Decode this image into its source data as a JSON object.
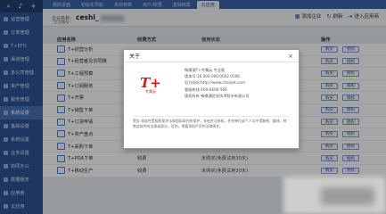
{
  "sidebar": {
    "top_icons": [
      "search-icon",
      "bell-icon",
      "add-icon"
    ],
    "items": [
      {
        "label": "运营管理"
      },
      {
        "label": "订单管理"
      },
      {
        "label": "T+EFO"
      },
      {
        "label": "渠道管理"
      },
      {
        "label": "多公司管理"
      },
      {
        "label": "资产管理"
      },
      {
        "label": "服务管理"
      },
      {
        "label": "系统设置",
        "active": true
      },
      {
        "label": "基础设置"
      },
      {
        "label": "系统设置"
      },
      {
        "label": "业务设置"
      },
      {
        "label": "协同办公"
      },
      {
        "label": "数据服务"
      },
      {
        "label": "应用商"
      },
      {
        "label": "云应用"
      }
    ]
  },
  "topbar": {
    "tabs": [
      {
        "label": "我的桌面"
      },
      {
        "label": "初始化导航"
      },
      {
        "label": "系统参数"
      },
      {
        "label": "用户/权限"
      },
      {
        "label": "基础档案"
      },
      {
        "label": "云应用",
        "active": true
      }
    ]
  },
  "account": {
    "label": "企业名称：",
    "name": "ceshi_",
    "sub": "企业编号："
  },
  "actions": {
    "add_account": "添加企业",
    "refresh": "刷新",
    "enter_app": "进入应用商"
  },
  "table": {
    "headers": {
      "app": "应用名称",
      "charge": "收费方式",
      "status": "使用状态",
      "ops": "操作"
    },
    "rows": [
      {
        "app": "T+经营分析",
        "charge": "",
        "status": "",
        "ops": [
          "购买",
          "授权"
        ]
      },
      {
        "app": "T+经营者及协同推",
        "charge": "",
        "status": "",
        "ops": [
          "购买",
          "授权"
        ]
      },
      {
        "app": "T+工程预算",
        "charge": "",
        "status": "",
        "ops": [
          "购买",
          "授权"
        ]
      },
      {
        "app": "T+订阅服务",
        "charge": "",
        "status": "",
        "ops": [
          "购买",
          "授权"
        ]
      },
      {
        "app": "T+开票",
        "charge": "",
        "status": "",
        "ops": [
          "购买",
          "授权"
        ]
      },
      {
        "app": "T+销售下单",
        "charge": "",
        "status": "",
        "ops": [
          "购买",
          "授权"
        ]
      },
      {
        "app": "T+订货申请",
        "charge": "",
        "status": "",
        "ops": [
          "购买",
          "授权"
        ]
      },
      {
        "app": "T+资产盘点",
        "charge": "收费",
        "status": "未购买(免费试用30天)",
        "ops": [
          "购买",
          "授权"
        ]
      },
      {
        "app": "T+采购下单",
        "charge": "收费",
        "status": "未购买(免费试用30天)",
        "ops": [
          "购买",
          "授权"
        ]
      },
      {
        "app": "T+PDA下单",
        "charge": "收费",
        "status": "未购买(免费试用30天)",
        "ops": [
          "购买",
          "授权"
        ]
      },
      {
        "app": "T+移动生产",
        "charge": "收费",
        "status": "未购买(免费试用30天)",
        "ops": [
          "购买",
          "授权"
        ]
      }
    ]
  },
  "modal": {
    "title": "关于",
    "close": "×",
    "logo": "T+",
    "logo_sub": "专属云",
    "info": [
      "畅捷通T+专属云 专业版",
      "版本号:16.000.000.0002.0166",
      "官方网站:http://www.chanjet.com",
      "客服热线:400-6600-566",
      "版权所有 畅捷通信息技术股份有限公司"
    ],
    "note": "警告:本软件受版权保护法和国际条约的保护，未经合法授权，任何单位或个人均不得复制、翻译、转售此软件的全部或部分，否则，将要承担严厉的法律责任。"
  },
  "colors": {
    "sidebar": "#2f5597",
    "brand_red": "#d6161d",
    "accent": "#3b64a9"
  }
}
